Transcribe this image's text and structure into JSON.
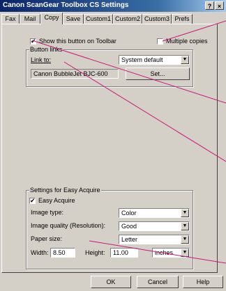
{
  "window": {
    "title": "Canon ScanGear Toolbox CS Settings",
    "help_glyph": "?",
    "close_glyph": "×"
  },
  "tabs": [
    "Fax",
    "Mail",
    "Copy",
    "Save",
    "Custom1",
    "Custom2",
    "Custom3",
    "Prefs"
  ],
  "copy_tab": {
    "show_on_toolbar": {
      "label": "Show this button on Toolbar",
      "checked": true
    },
    "multiple_copies": {
      "label": "Multiple copies",
      "checked": false
    },
    "button_links": {
      "title": "Button links",
      "link_label": "Link to:",
      "link_value": "System default",
      "device": "Canon BubbleJet BJC-600",
      "set_button": "Set..."
    },
    "easy_acquire": {
      "title": "Settings for Easy Acquire",
      "checkbox_label": "Easy Acquire",
      "checked": true,
      "image_type_label": "Image type:",
      "image_type_value": "Color",
      "image_quality_label": "Image quality (Resolution):",
      "image_quality_value": "Good",
      "paper_size_label": "Paper size:",
      "paper_size_value": "Letter",
      "width_label": "Width:",
      "width_value": "8.50",
      "height_label": "Height:",
      "height_value": "11.00",
      "unit_value": "inches"
    }
  },
  "footer": {
    "ok": "OK",
    "cancel": "Cancel",
    "help": "Help"
  },
  "check_glyph": "✔",
  "dropdown_glyph": "▼",
  "colors": {
    "callout_line": "#c8187a",
    "titlebar": "#0a246a"
  }
}
